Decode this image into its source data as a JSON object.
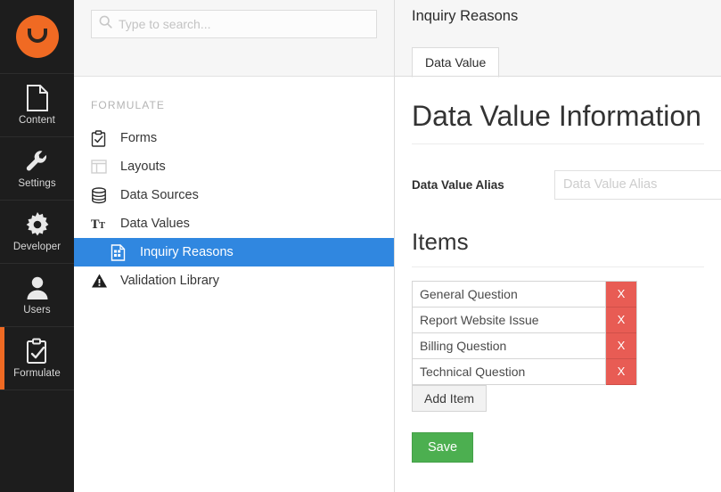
{
  "brand": {
    "logo_name": "umbraco-logo",
    "accent": "#f06a23",
    "highlight": "#3087e0",
    "danger": "#e85c54",
    "success": "#4caf50"
  },
  "rail": {
    "items": [
      {
        "label": "Content",
        "icon": "document-icon",
        "active": false
      },
      {
        "label": "Settings",
        "icon": "wrench-icon",
        "active": false
      },
      {
        "label": "Developer",
        "icon": "gear-icon",
        "active": false
      },
      {
        "label": "Users",
        "icon": "user-icon",
        "active": false
      },
      {
        "label": "Formulate",
        "icon": "clipboard-check-icon",
        "active": true
      }
    ]
  },
  "search": {
    "placeholder": "Type to search...",
    "value": "",
    "icon": "search-icon"
  },
  "tree": {
    "section_title": "FORMULATE",
    "nodes": [
      {
        "label": "Forms",
        "icon": "clipboard-check-icon",
        "child": false,
        "selected": false
      },
      {
        "label": "Layouts",
        "icon": "layout-columns-icon",
        "child": false,
        "selected": false
      },
      {
        "label": "Data Sources",
        "icon": "database-icon",
        "child": false,
        "selected": false
      },
      {
        "label": "Data Values",
        "icon": "text-size-icon",
        "child": false,
        "selected": false
      },
      {
        "label": "Inquiry Reasons",
        "icon": "data-value-document-icon",
        "child": true,
        "selected": true
      },
      {
        "label": "Validation Library",
        "icon": "warning-triangle-icon",
        "child": false,
        "selected": false
      }
    ]
  },
  "content": {
    "title": "Inquiry Reasons",
    "tabs": [
      {
        "label": "Data Value",
        "active": true
      }
    ],
    "info_heading": "Data Value Information",
    "alias_field": {
      "label": "Data Value Alias",
      "placeholder": "Data Value Alias",
      "value": ""
    },
    "items_heading": "Items",
    "items": [
      {
        "value": "General Question",
        "remove_label": "X"
      },
      {
        "value": "Report Website Issue",
        "remove_label": "X"
      },
      {
        "value": "Billing Question",
        "remove_label": "X"
      },
      {
        "value": "Technical Question",
        "remove_label": "X"
      }
    ],
    "add_item_label": "Add Item",
    "save_label": "Save"
  }
}
